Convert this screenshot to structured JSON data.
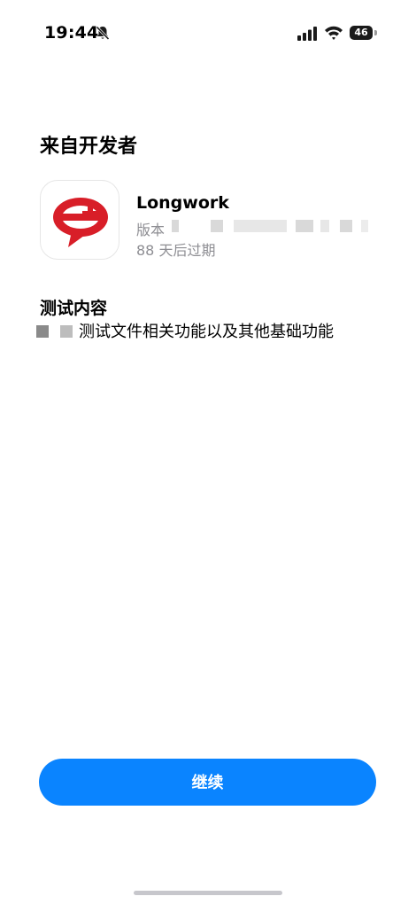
{
  "status_bar": {
    "time": "19:44",
    "battery": "46",
    "icons": [
      "bell-slash-icon",
      "cellular-signal-icon",
      "wifi-icon",
      "battery-icon"
    ]
  },
  "header": {
    "title": "来自开发者"
  },
  "app": {
    "name": "Longwork",
    "version_label": "版本",
    "expiry": "88 天后过期",
    "icon": "longwork-app-icon",
    "brand_color": "#d81e28"
  },
  "test_section": {
    "title": "测试内容",
    "description": "测试文件相关功能以及其他基础功能"
  },
  "actions": {
    "continue_label": "继续",
    "accent_color": "#0a84ff"
  }
}
